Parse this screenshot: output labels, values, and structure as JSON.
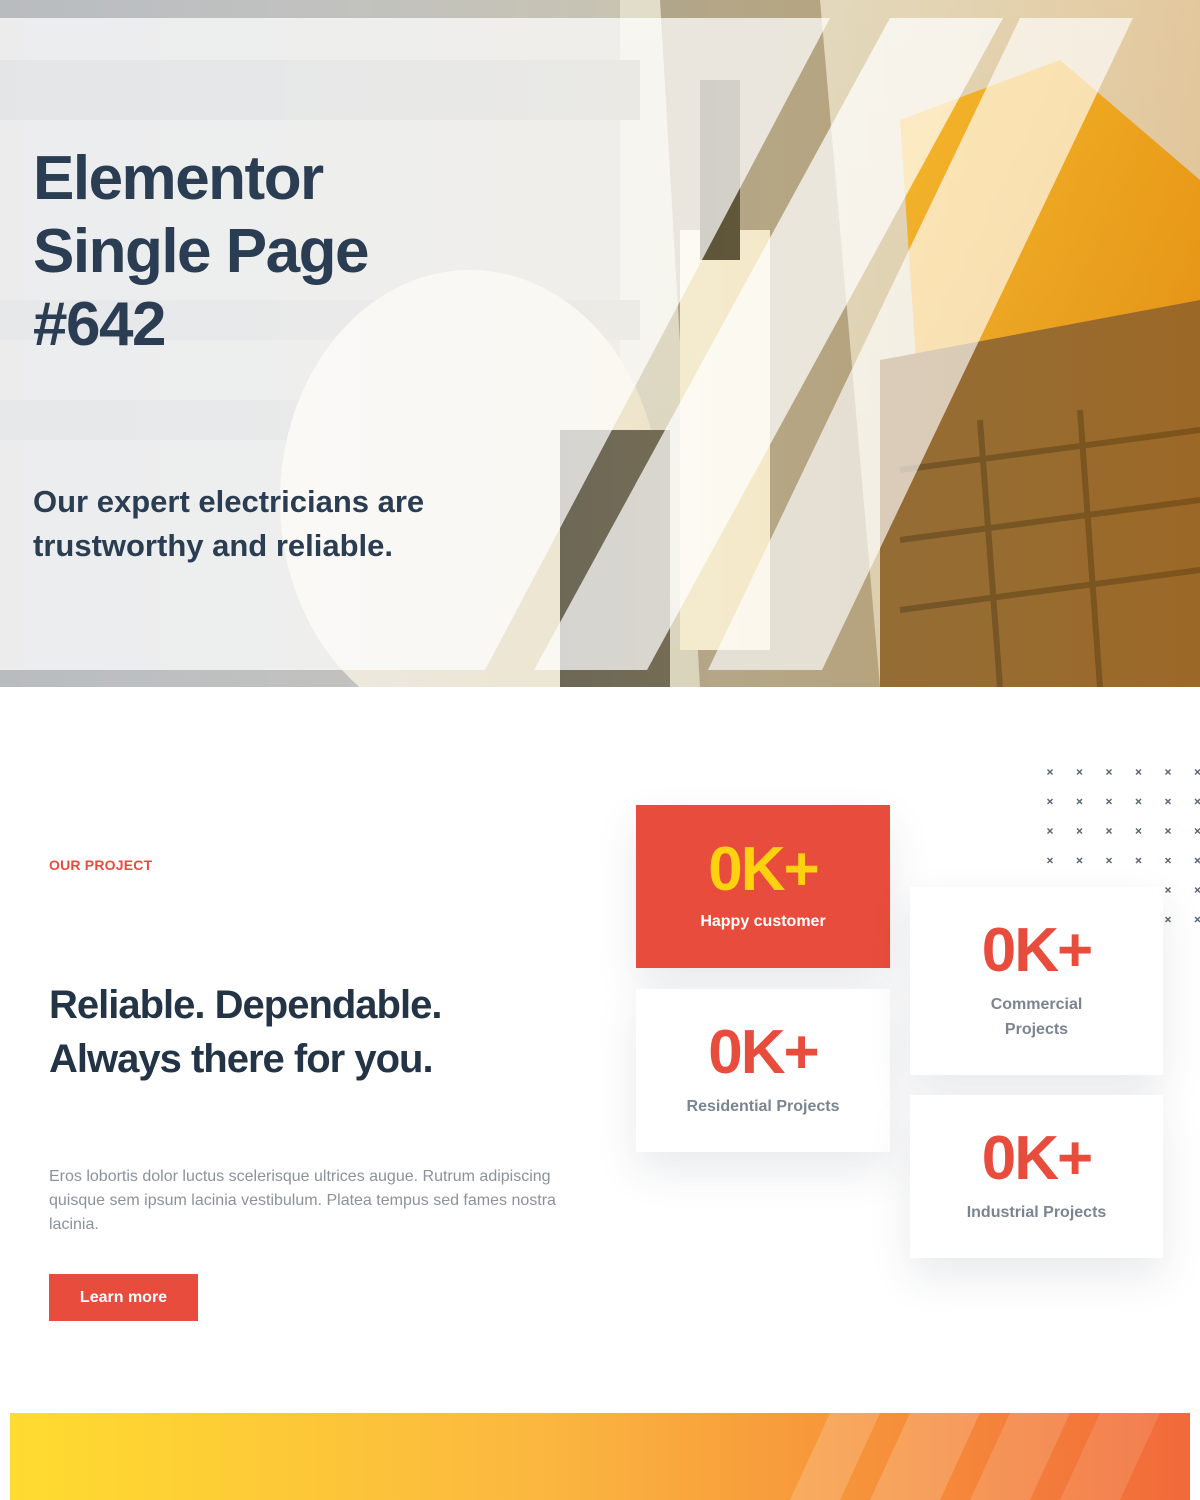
{
  "hero": {
    "title_lines": [
      "Elementor",
      "Single Page",
      "#642"
    ],
    "subtitle_lines": [
      "Our expert electricians are",
      "trustworthy and reliable."
    ]
  },
  "project": {
    "eyebrow": "OUR PROJECT",
    "title_lines": [
      "Reliable. Dependable.",
      "Always there for you."
    ],
    "body": "Eros lobortis dolor luctus scelerisque ultrices augue. Rutrum adipiscing quisque sem ipsum lacinia vestibulum. Platea tempus sed fames nostra lacinia.",
    "button_label": "Learn more"
  },
  "stats": [
    {
      "value": "0K+",
      "label": "Happy customer"
    },
    {
      "value": "0K+",
      "label": "Residential Projects"
    },
    {
      "value": "0K+",
      "label": "Commercial Projects"
    },
    {
      "value": "0K+",
      "label": "Industrial Projects"
    }
  ],
  "colors": {
    "accent": "#e84c3d",
    "highlight": "#ffd20f",
    "heading": "#233447",
    "muted": "#8a929b"
  }
}
